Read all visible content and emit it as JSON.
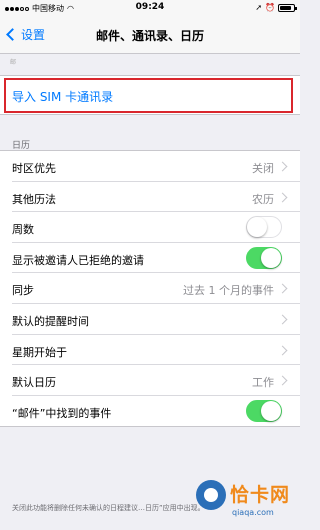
{
  "status_bar": {
    "carrier": "中国移动",
    "time": "09:24",
    "alarm_icon": "alarm-clock-icon",
    "signal_icon": "signal-dots-icon",
    "battery_icon": "battery-icon",
    "battery_level": 0.85
  },
  "nav": {
    "back_label": "设置",
    "title": "邮件、通讯录、日历"
  },
  "top_faint": "邮",
  "import_sim": {
    "label": "导入 SIM 卡通讯录",
    "highlight_color": "#d9262c"
  },
  "calendar_section": {
    "header": "日历",
    "rows": [
      {
        "label": "时区优先",
        "value": "关闭"
      },
      {
        "label": "其他历法",
        "value": "农历"
      },
      {
        "label": "周数"
      },
      {
        "label": "显示被邀请人已拒绝的邀请"
      },
      {
        "label": "同步",
        "value": "过去 1 个月的事件"
      },
      {
        "label": "默认的提醒时间"
      },
      {
        "label": "星期开始于"
      },
      {
        "label": "默认日历",
        "value": "工作"
      },
      {
        "label": "“邮件”中找到的事件"
      }
    ],
    "toggles": {
      "week_numbers": false,
      "show_declined": true,
      "mail_events": true
    }
  },
  "footer_note": "关闭此功能将删除任何未确认的日程建议…日历”应用中出现。",
  "watermark": {
    "title": "恰卡网",
    "url": "qiaqa.com"
  },
  "colors": {
    "accent": "#007aff",
    "toggle_on": "#4cd964",
    "highlight": "#d9262c"
  }
}
